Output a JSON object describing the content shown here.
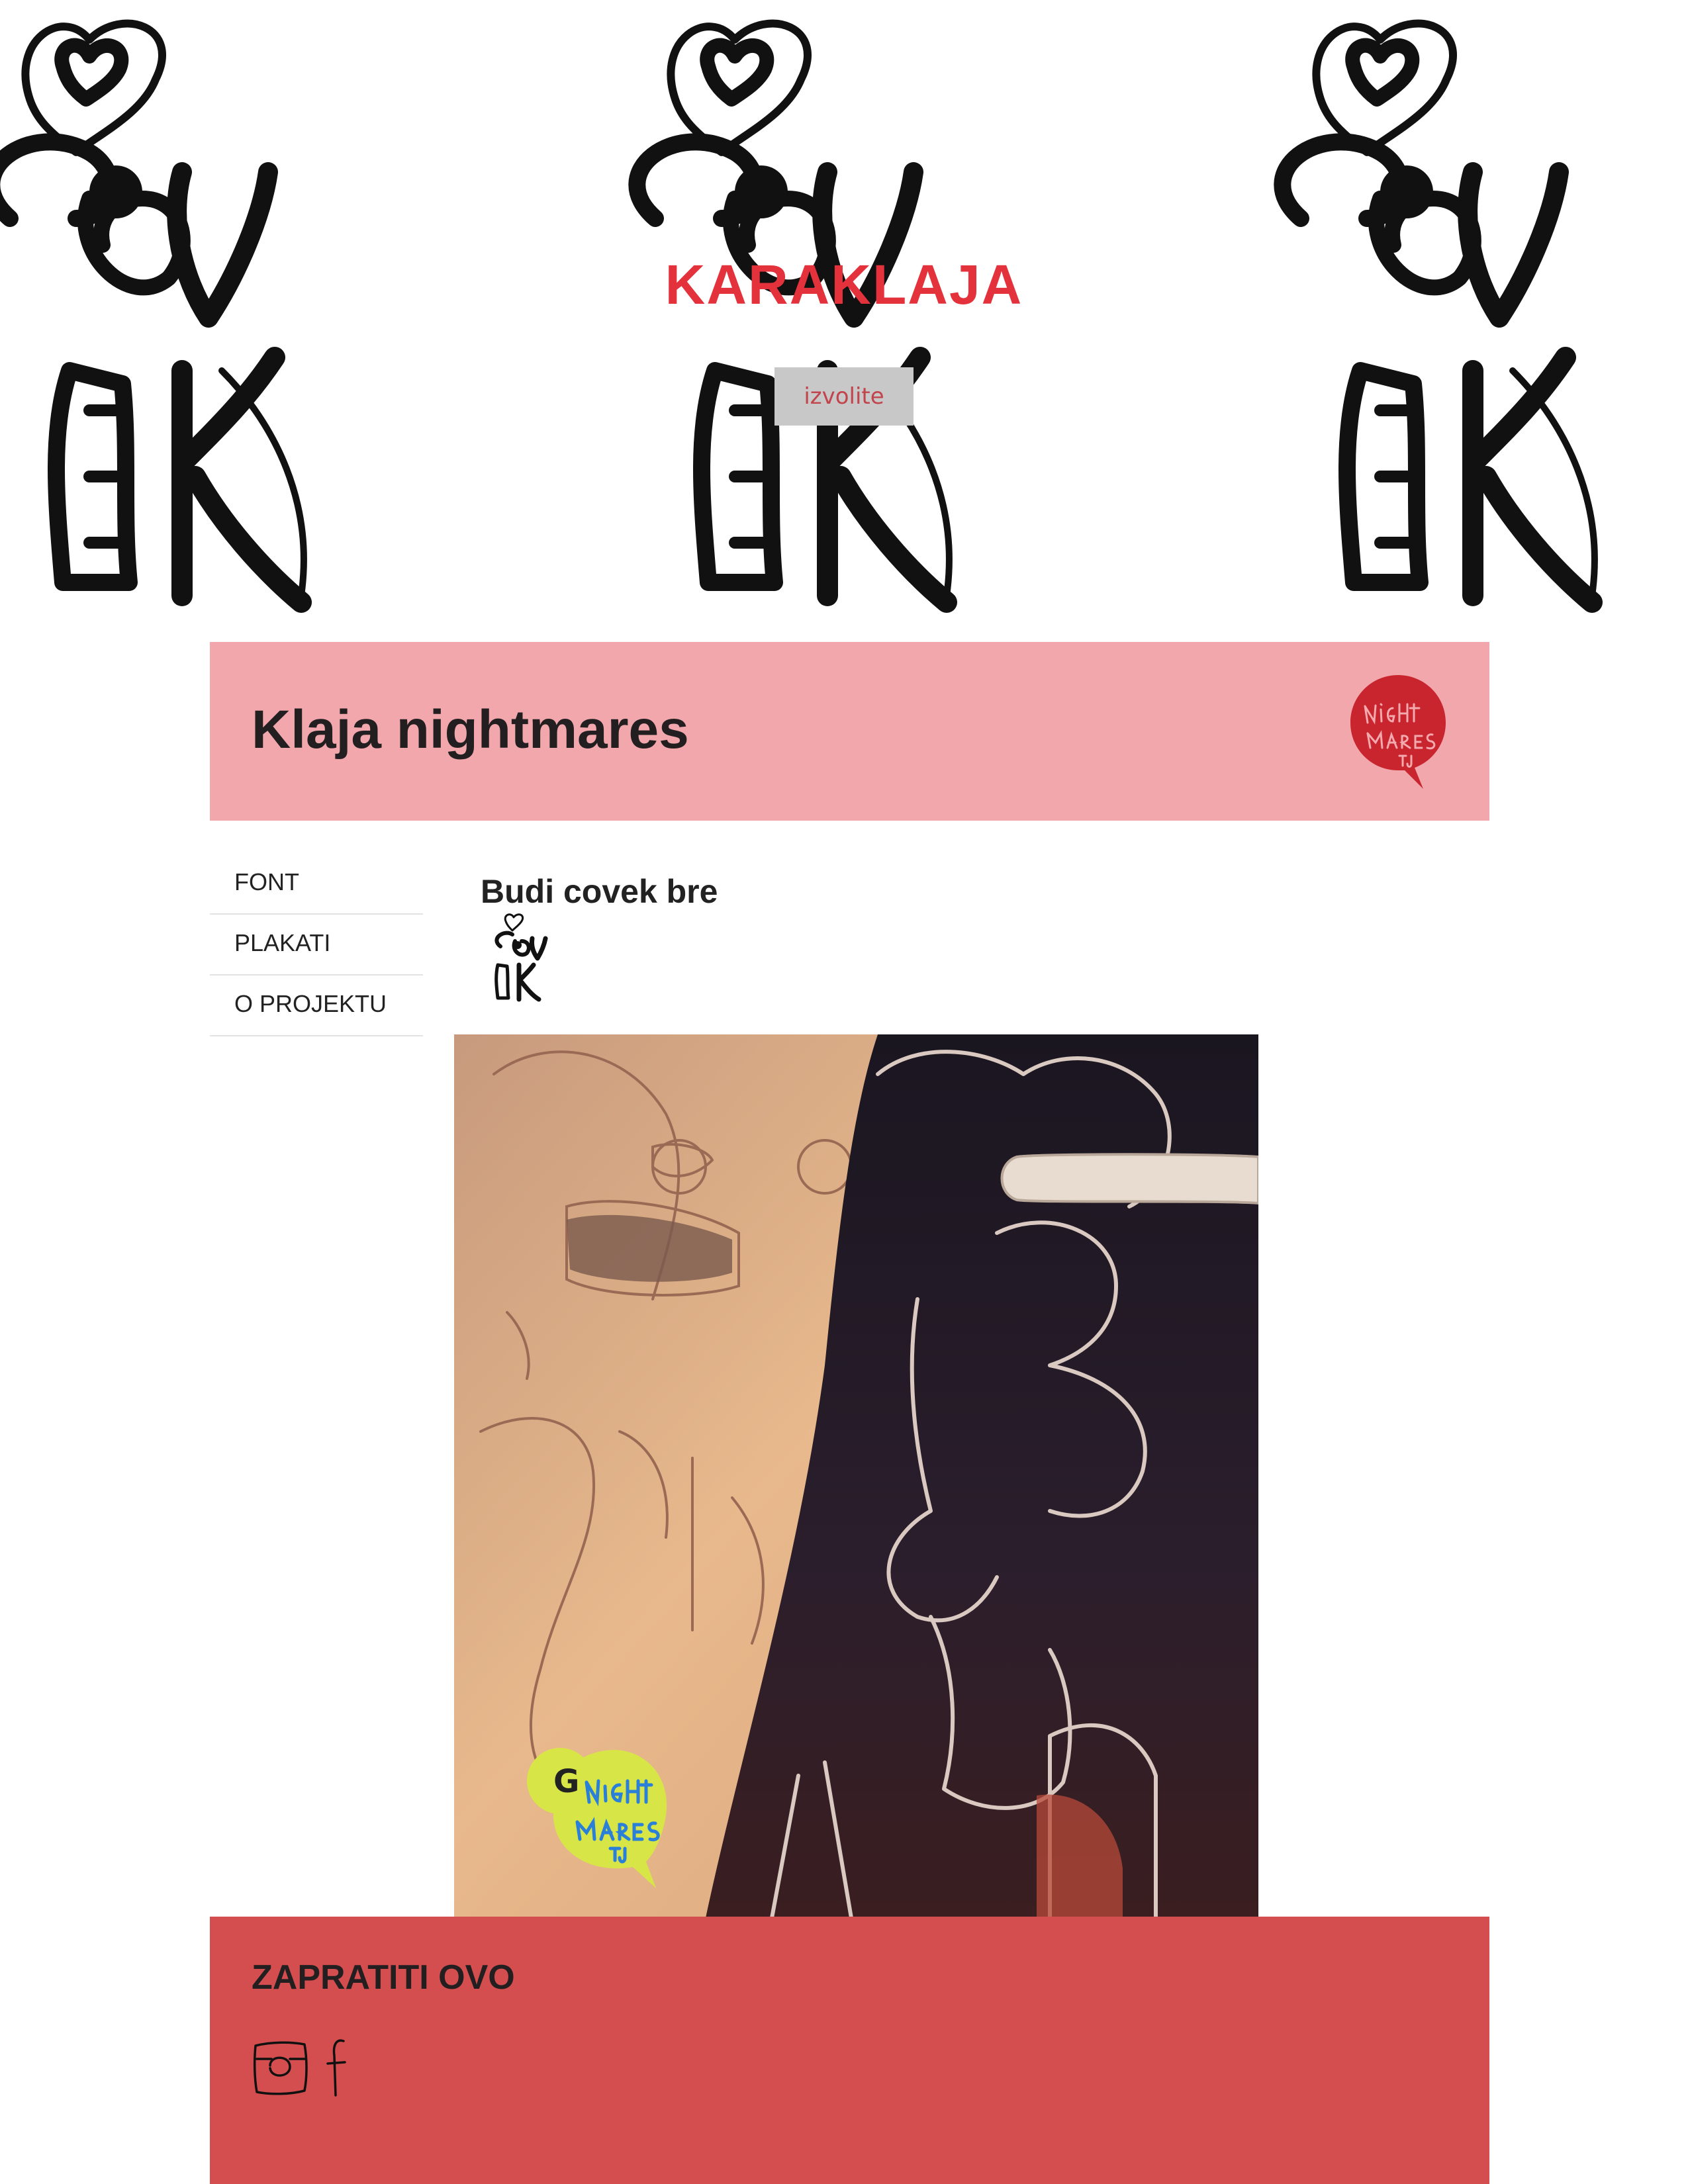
{
  "hero": {
    "title": "KARAKLAJA",
    "button_label": "izvolite"
  },
  "header": {
    "site_title": "Klaja nightmares"
  },
  "nav": {
    "items": [
      {
        "label": "FONT"
      },
      {
        "label": "PLAKATI"
      },
      {
        "label": "O PROJEKTU"
      }
    ]
  },
  "post": {
    "title": "Budi covek bre"
  },
  "footer": {
    "heading": "ZAPRATITI OVO"
  },
  "colors": {
    "hero_title": "#e4323c",
    "header_band": "#f2a7ad",
    "footer_band": "#d44e4f",
    "logo_red": "#c9252f",
    "sticker_lime": "#d7e646"
  },
  "icons": [
    "instagram-icon",
    "facebook-icon",
    "nightmares-logo",
    "covek-thumbnail"
  ]
}
